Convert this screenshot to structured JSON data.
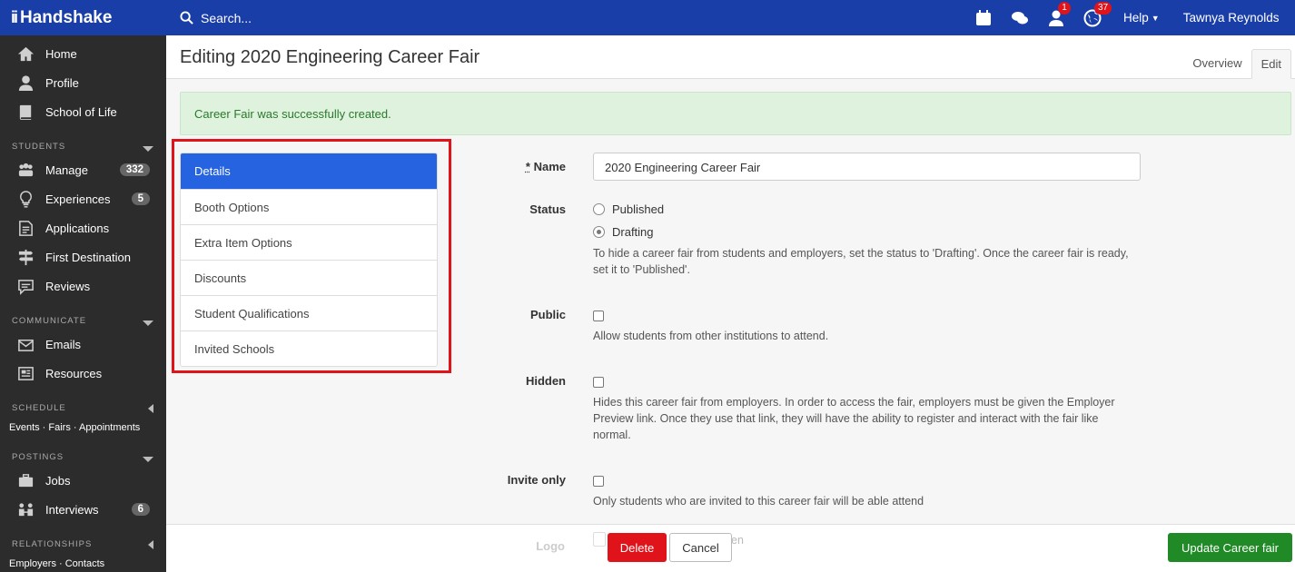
{
  "topbar": {
    "brand": "Handshake",
    "search_placeholder": "Search...",
    "badges": {
      "user_count": "1",
      "globe_count": "37"
    },
    "help_label": "Help",
    "user_name": "Tawnya Reynolds",
    "colors": {
      "bar": "#1a3ea8",
      "badge": "#e0131b"
    }
  },
  "sidebar": {
    "top_items": [
      {
        "label": "Home",
        "icon": "home-icon"
      },
      {
        "label": "Profile",
        "icon": "user-icon"
      },
      {
        "label": "School of Life",
        "icon": "book-icon"
      }
    ],
    "students": {
      "heading": "STUDENTS",
      "items": [
        {
          "label": "Manage",
          "count": "332",
          "icon": "group-icon"
        },
        {
          "label": "Experiences",
          "count": "5",
          "icon": "lightbulb-icon"
        },
        {
          "label": "Applications",
          "icon": "document-icon"
        },
        {
          "label": "First Destination",
          "icon": "signpost-icon"
        },
        {
          "label": "Reviews",
          "icon": "comment-icon"
        }
      ]
    },
    "communicate": {
      "heading": "COMMUNICATE",
      "items": [
        {
          "label": "Emails",
          "icon": "envelope-icon"
        },
        {
          "label": "Resources",
          "icon": "newspaper-icon"
        }
      ]
    },
    "schedule": {
      "heading": "SCHEDULE",
      "links": "Events · Fairs · Appointments"
    },
    "postings": {
      "heading": "POSTINGS",
      "items": [
        {
          "label": "Jobs",
          "icon": "briefcase-icon"
        },
        {
          "label": "Interviews",
          "count": "6",
          "icon": "interview-icon"
        }
      ]
    },
    "relationships": {
      "heading": "RELATIONSHIPS",
      "links": "Employers · Contacts"
    }
  },
  "header": {
    "title": "Editing 2020 Engineering Career Fair",
    "tabs": [
      {
        "label": "Overview"
      },
      {
        "label": "Edit"
      }
    ]
  },
  "alert": {
    "message": "Career Fair was successfully created."
  },
  "tablist": [
    {
      "label": "Details"
    },
    {
      "label": "Booth Options"
    },
    {
      "label": "Extra Item Options"
    },
    {
      "label": "Discounts"
    },
    {
      "label": "Student Qualifications"
    },
    {
      "label": "Invited Schools"
    }
  ],
  "form": {
    "name": {
      "required_mark": "*",
      "label": "Name",
      "value": "2020 Engineering Career Fair"
    },
    "status": {
      "label": "Status",
      "options": [
        {
          "label": "Published",
          "selected": false
        },
        {
          "label": "Drafting",
          "selected": true
        }
      ],
      "help": "To hide a career fair from students and employers, set the status to 'Drafting'. Once the career fair is ready, set it to 'Published'."
    },
    "public": {
      "label": "Public",
      "help": "Allow students from other institutions to attend."
    },
    "hidden": {
      "label": "Hidden",
      "help": "Hides this career fair from employers. In order to access the fair, employers must be given the Employer Preview link. Once they use that link, they will have the ability to register and interact with the fair like normal."
    },
    "invite_only": {
      "label": "Invite only",
      "help": "Only students who are invited to this career fair will be able attend"
    },
    "logo": {
      "label": "Logo",
      "partial_text": "en"
    }
  },
  "footer": {
    "delete_label": "Delete",
    "cancel_label": "Cancel",
    "update_label": "Update Career fair"
  }
}
